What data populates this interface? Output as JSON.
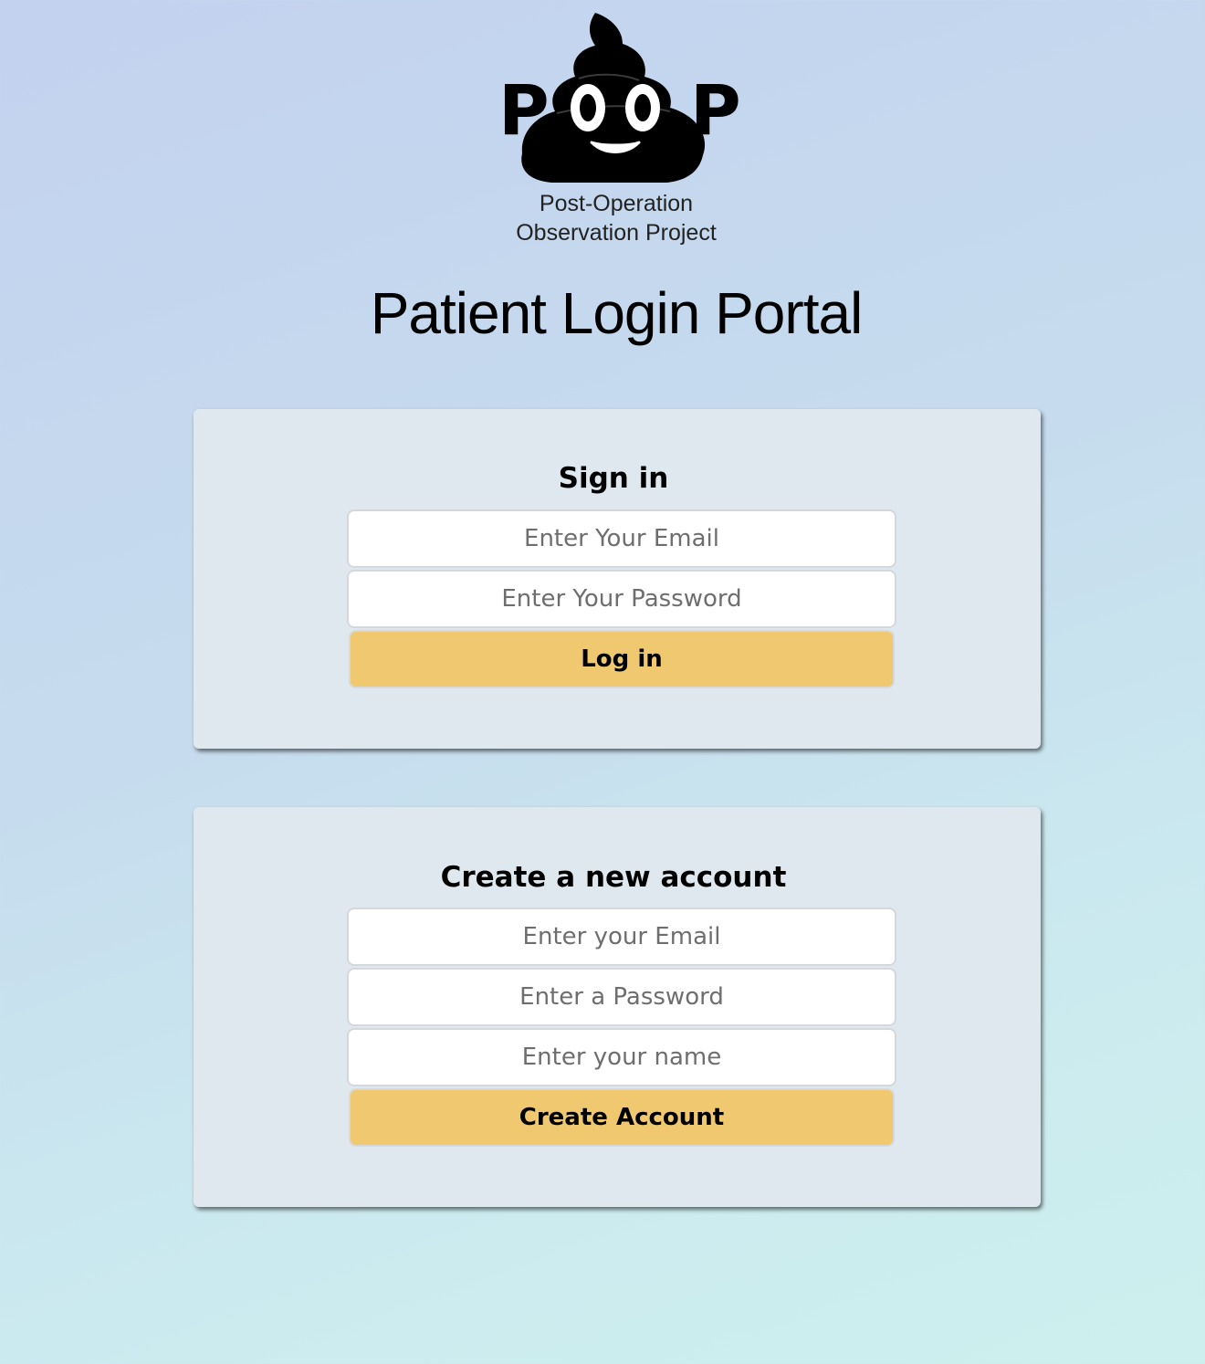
{
  "logo": {
    "letters": [
      "P",
      "P"
    ],
    "subtitle_line1": "Post-Operation",
    "subtitle_line2": "Observation Project"
  },
  "page_title": "Patient Login Portal",
  "sign_in": {
    "title": "Sign in",
    "email_placeholder": "Enter Your Email",
    "password_placeholder": "Enter Your Password",
    "submit_label": "Log in"
  },
  "create_account": {
    "title": "Create a new account",
    "email_placeholder": "Enter your Email",
    "password_placeholder": "Enter a Password",
    "name_placeholder": "Enter your name",
    "submit_label": "Create Account"
  },
  "colors": {
    "button": "#efc86f",
    "card": "#e0e8ef",
    "logo": "#000000"
  }
}
